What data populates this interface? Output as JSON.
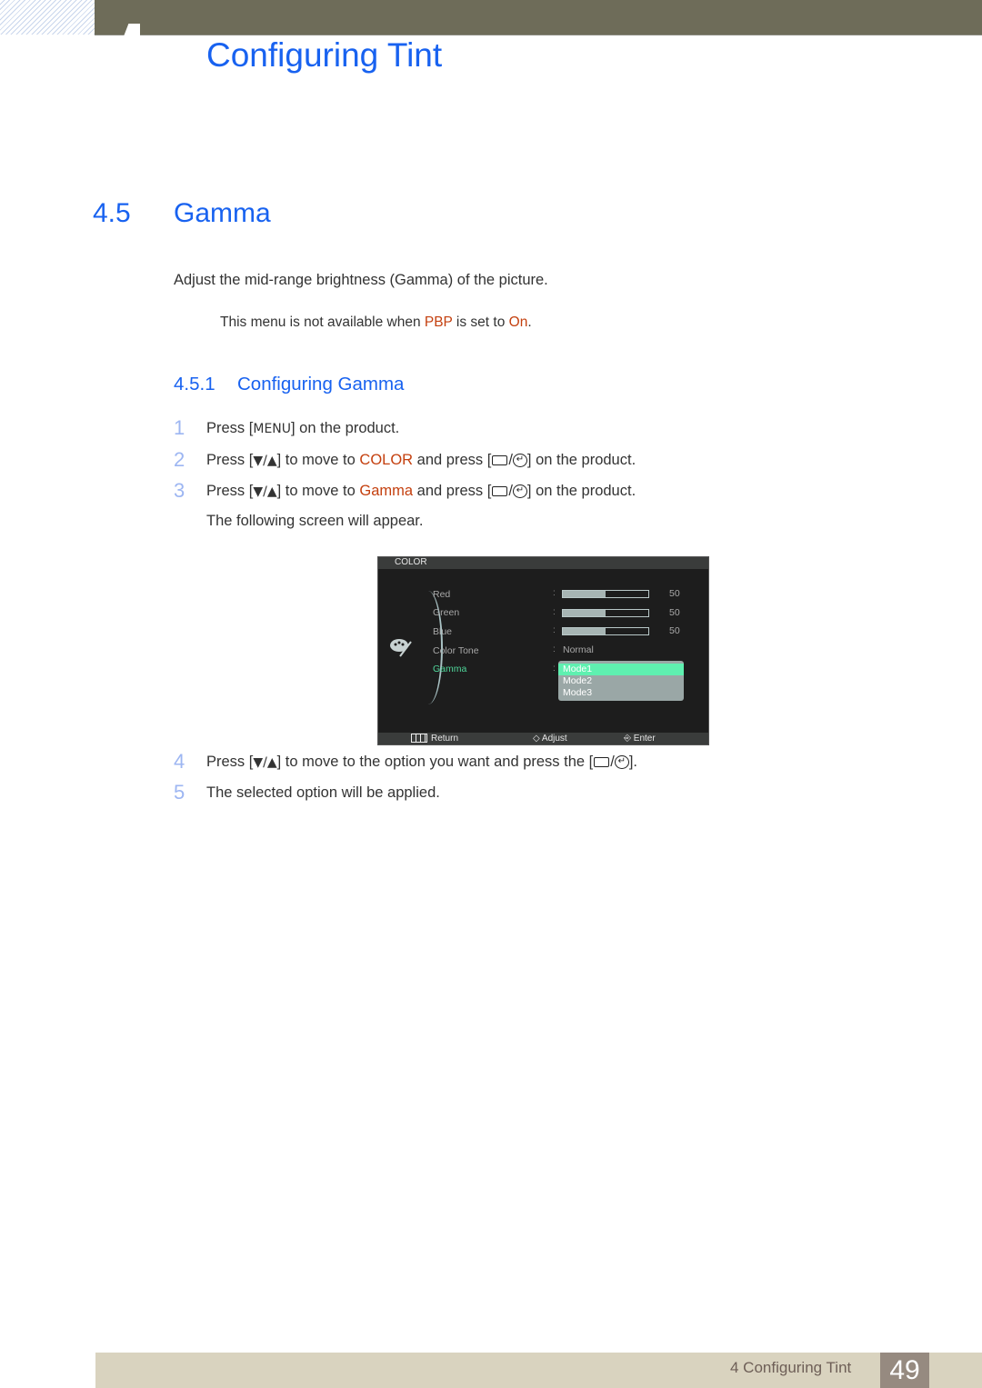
{
  "header": {
    "chapter_title": "Configuring Tint"
  },
  "section": {
    "number": "4.5",
    "title": "Gamma",
    "intro": "Adjust the mid-range brightness (Gamma) of the picture.",
    "note": {
      "prefix": "This menu is not available when ",
      "hl1": "PBP",
      "middle": " is set to ",
      "hl2": "On",
      "suffix": "."
    }
  },
  "subsection": {
    "number": "4.5.1",
    "title": "Configuring Gamma"
  },
  "steps": [
    {
      "num": "1",
      "pre": "Press [",
      "key": "MENU",
      "post": "] on the product."
    },
    {
      "num": "2",
      "pre": "Press [",
      "arrows": "▼/▲",
      "mid": "] to move to ",
      "hl": "COLOR",
      "mid2": " and press [",
      "post": "] on the product."
    },
    {
      "num": "3",
      "pre": "Press [",
      "arrows": "▼/▲",
      "mid": "] to move to ",
      "hl": "Gamma",
      "mid2": " and press [",
      "post": "] on the product."
    },
    {
      "num": "",
      "text": "The following screen will appear."
    },
    {
      "num": "4",
      "pre": "Press [",
      "arrows": "▼/▲",
      "mid": "] to move to the option you want and press the [",
      "post": "]."
    },
    {
      "num": "5",
      "text": "The selected option will be applied."
    }
  ],
  "osd": {
    "title": "COLOR",
    "items": [
      {
        "label": "Red",
        "value": "50",
        "level": 0.5
      },
      {
        "label": "Green",
        "value": "50",
        "level": 0.5
      },
      {
        "label": "Blue",
        "value": "50",
        "level": 0.5
      },
      {
        "label": "Color Tone",
        "value": "Normal"
      },
      {
        "label": "Gamma",
        "active": true
      }
    ],
    "gamma_options": [
      "Mode1",
      "Mode2",
      "Mode3"
    ],
    "selected_option": "Mode1",
    "footer": {
      "return": "Return",
      "adjust": "Adjust",
      "enter": "Enter"
    },
    "colors": {
      "active": "#4fd69a",
      "selected_bg": "#5ff0b0"
    }
  },
  "footer": {
    "label": "4 Configuring Tint",
    "page": "49"
  },
  "colors": {
    "heading": "#1862f0",
    "highlight": "#c4400f",
    "step_number": "#9db6f2"
  }
}
